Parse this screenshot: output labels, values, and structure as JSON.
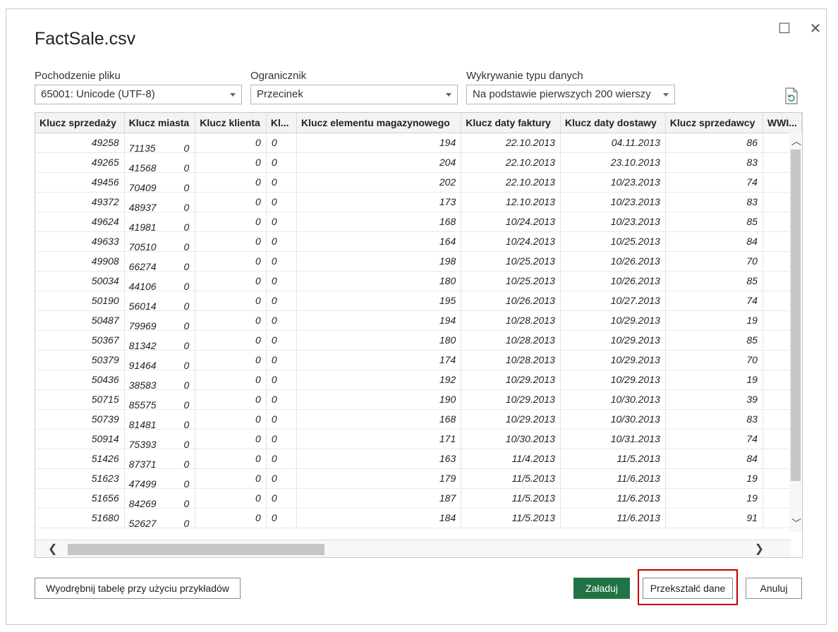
{
  "window": {
    "title": "FactSale.csv",
    "maximize_glyph": "☐",
    "close_glyph": "✕"
  },
  "controls": {
    "origin": {
      "label": "Pochodzenie pliku",
      "value": "65001: Unicode (UTF-8)"
    },
    "delimiter": {
      "label": "Ogranicznik",
      "value": "Przecinek"
    },
    "detection": {
      "label": "Wykrywanie typu danych",
      "value": "Na podstawie pierwszych 200 wierszy"
    }
  },
  "table": {
    "columns": [
      "Klucz sprzedaży",
      "Klucz miasta",
      "Klucz klienta",
      "Kl...",
      "Klucz elementu magazynowego",
      "Klucz daty faktury",
      "Klucz daty dostawy",
      "Klucz sprzedawcy",
      "WWI..."
    ],
    "rows": [
      [
        "49258",
        "71135",
        "0",
        "0",
        "0",
        "194",
        "22.10.2013",
        "04.11.2013",
        "86"
      ],
      [
        "49265",
        "41568",
        "0",
        "0",
        "0",
        "204",
        "22.10.2013",
        "23.10.2013",
        "83"
      ],
      [
        "49456",
        "70409",
        "0",
        "0",
        "0",
        "202",
        "22.10.2013",
        "10/23.2013",
        "74"
      ],
      [
        "49372",
        "48937",
        "0",
        "0",
        "0",
        "173",
        "12.10.2013",
        "10/23.2013",
        "83"
      ],
      [
        "49624",
        "41981",
        "0",
        "0",
        "0",
        "168",
        "10/24.2013",
        "10/23.2013",
        "85"
      ],
      [
        "49633",
        "70510",
        "0",
        "0",
        "0",
        "164",
        "10/24.2013",
        "10/25.2013",
        "84"
      ],
      [
        "49908",
        "66274",
        "0",
        "0",
        "0",
        "198",
        "10/25.2013",
        "10/26.2013",
        "70"
      ],
      [
        "50034",
        "44106",
        "0",
        "0",
        "0",
        "180",
        "10/25.2013",
        "10/26.2013",
        "85"
      ],
      [
        "50190",
        "56014",
        "0",
        "0",
        "0",
        "195",
        "10/26.2013",
        "10/27.2013",
        "74"
      ],
      [
        "50487",
        "79969",
        "0",
        "0",
        "0",
        "194",
        "10/28.2013",
        "10/29.2013",
        "19"
      ],
      [
        "50367",
        "81342",
        "0",
        "0",
        "0",
        "180",
        "10/28.2013",
        "10/29.2013",
        "85"
      ],
      [
        "50379",
        "91464",
        "0",
        "0",
        "0",
        "174",
        "10/28.2013",
        "10/29.2013",
        "70"
      ],
      [
        "50436",
        "38583",
        "0",
        "0",
        "0",
        "192",
        "10/29.2013",
        "10/29.2013",
        "19"
      ],
      [
        "50715",
        "85575",
        "0",
        "0",
        "0",
        "190",
        "10/29.2013",
        "10/30.2013",
        "39"
      ],
      [
        "50739",
        "81481",
        "0",
        "0",
        "0",
        "168",
        "10/29.2013",
        "10/30.2013",
        "83"
      ],
      [
        "50914",
        "75393",
        "0",
        "0",
        "0",
        "171",
        "10/30.2013",
        "10/31.2013",
        "74"
      ],
      [
        "51426",
        "87371",
        "0",
        "0",
        "0",
        "163",
        "11/4.2013",
        "11/5.2013",
        "84"
      ],
      [
        "51623",
        "47499",
        "0",
        "0",
        "0",
        "179",
        "11/5.2013",
        "11/6.2013",
        "19"
      ],
      [
        "51656",
        "84269",
        "0",
        "0",
        "0",
        "187",
        "11/5.2013",
        "11/6.2013",
        "19"
      ],
      [
        "51680",
        "52627",
        "0",
        "0",
        "0",
        "184",
        "11/5.2013",
        "11/6.2013",
        "91"
      ]
    ]
  },
  "buttons": {
    "extract": "Wyodrębnij tabelę przy użyciu przykładów",
    "load": "Załaduj",
    "transform": "Przekształć dane",
    "cancel": "Anuluj"
  },
  "colors": {
    "primary": "#217346",
    "highlight": "#c00000"
  }
}
